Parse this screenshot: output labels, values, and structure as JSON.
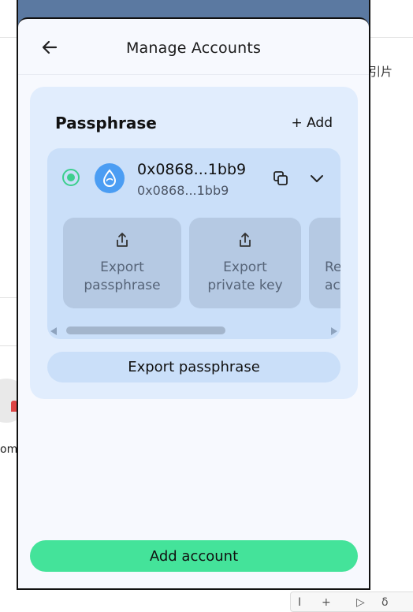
{
  "background": {
    "cn_text": "引片",
    "partial_text": "om",
    "bottom_glyphs": [
      "I",
      "+",
      "▷",
      "δ"
    ]
  },
  "header": {
    "title": "Manage Accounts",
    "back_icon": "arrow-left-icon"
  },
  "group": {
    "title": "Passphrase",
    "add_label": "+ Add",
    "account": {
      "address": "0x0868...1bb9",
      "address_sub": "0x0868...1bb9",
      "selected": true,
      "avatar_icon": "sui-drop-icon",
      "copy_icon": "copy-icon",
      "expand_icon": "chevron-down-icon"
    },
    "actions": [
      {
        "label": "Export\npassphrase",
        "icon": "share-icon"
      },
      {
        "label": "Export\nprivate key",
        "icon": "share-icon"
      },
      {
        "label": "Re\nac",
        "icon": "share-icon"
      }
    ],
    "export_button": "Export passphrase"
  },
  "footer": {
    "add_account": "Add account"
  },
  "colors": {
    "accent_green": "#44e39a",
    "card_bg": "#e1edfd",
    "account_bg": "#cadff9",
    "tile_bg": "#b5c9e3",
    "avatar_blue": "#4b9df3"
  }
}
